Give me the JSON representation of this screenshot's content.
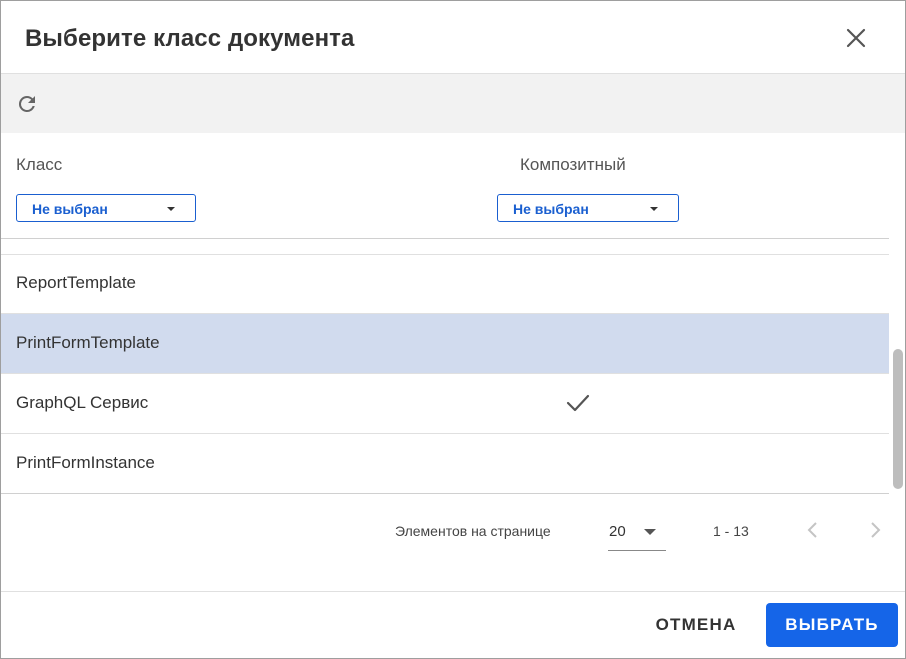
{
  "dialog": {
    "title": "Выберите класс документа"
  },
  "toolbar": {
    "refresh_icon": "refresh-icon"
  },
  "filters": {
    "class_label": "Класс",
    "class_value": "Не выбран",
    "composite_label": "Композитный",
    "composite_value": "Не выбран"
  },
  "rows": [
    {
      "name": "ReportTemplate",
      "composite": false,
      "selected": false
    },
    {
      "name": "PrintFormTemplate",
      "composite": false,
      "selected": true
    },
    {
      "name": "GraphQL Сервис",
      "composite": true,
      "selected": false
    },
    {
      "name": "PrintFormInstance",
      "composite": false,
      "selected": false
    }
  ],
  "paginator": {
    "items_per_page_label": "Элементов на странице",
    "page_size": "20",
    "range": "1 - 13"
  },
  "footer": {
    "cancel_label": "ОТМЕНА",
    "select_label": "ВЫБРАТЬ"
  },
  "colors": {
    "accent": "#1565e8",
    "selected_row": "#d1dbee",
    "toolbar_bg": "#f2f2f2"
  }
}
